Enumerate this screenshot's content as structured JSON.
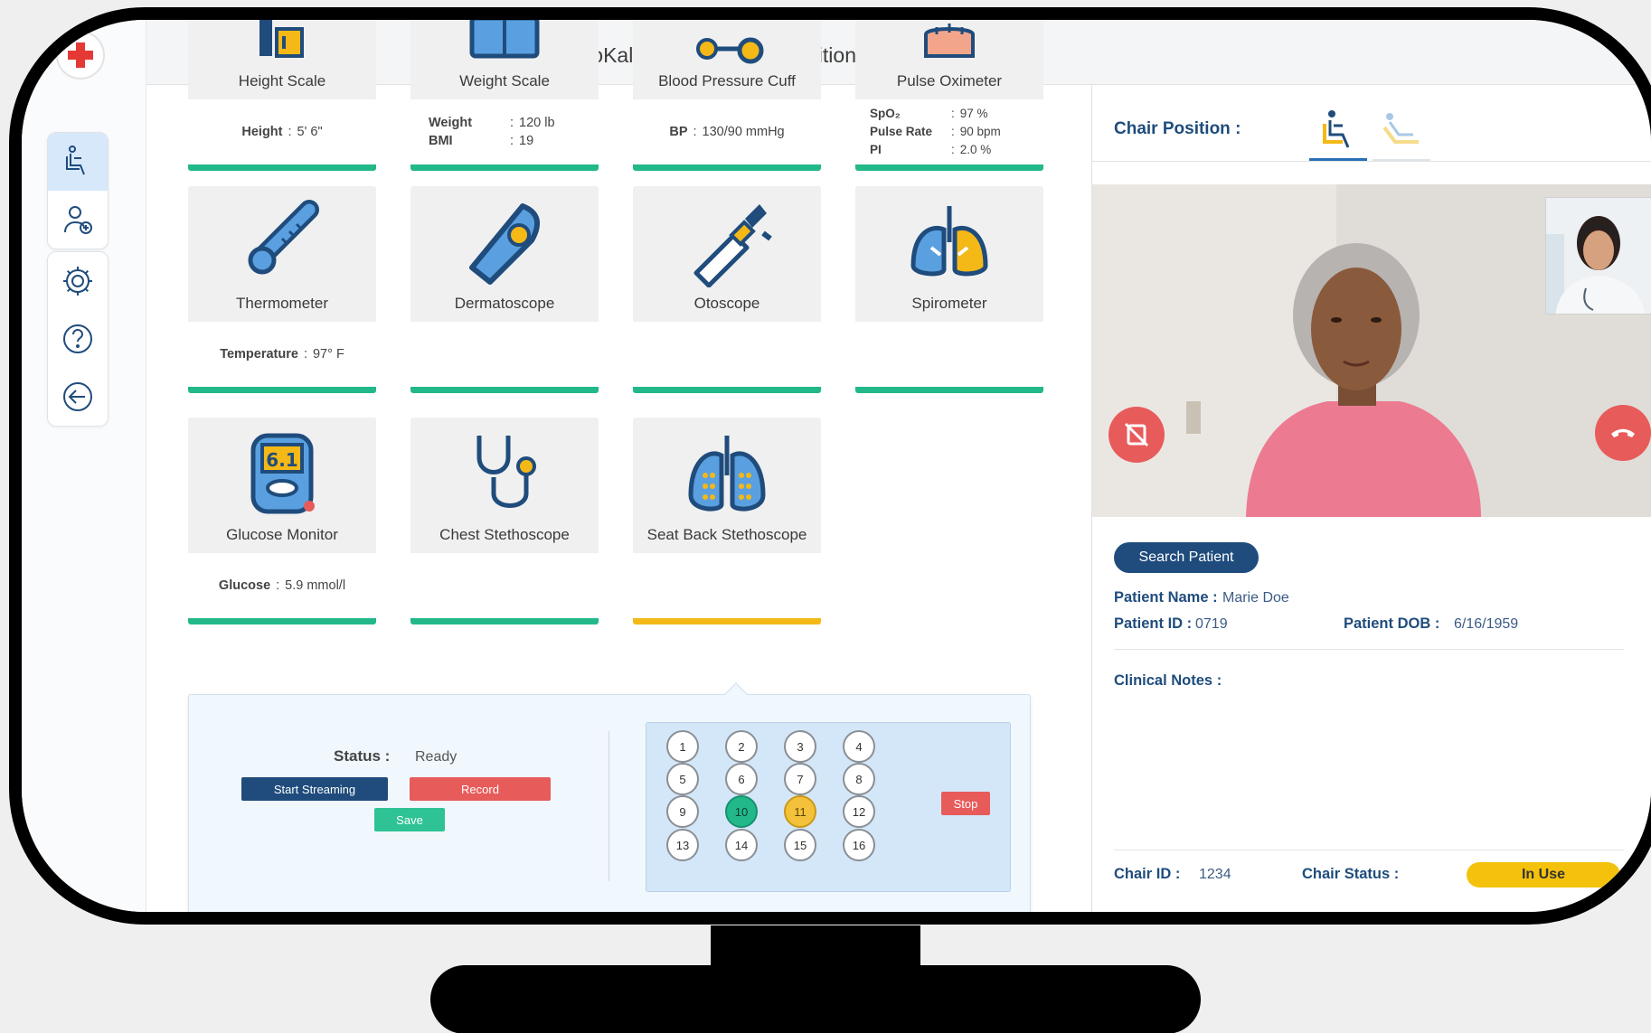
{
  "window": {
    "title": "VideoKall SMC - Nurse Practitioner Terminal"
  },
  "colors": {
    "navy": "#1f4c7c",
    "green_bar": "#22b88a",
    "yellow_bar": "#f4b817",
    "record": "#e75b5b"
  },
  "sidebar": {
    "items": [
      {
        "icon": "chair-patient-icon",
        "active": true
      },
      {
        "icon": "doctor-add-icon",
        "active": false
      },
      {
        "icon": "gear-icon",
        "active": false
      },
      {
        "icon": "help-icon",
        "active": false
      },
      {
        "icon": "logout-icon",
        "active": false
      }
    ]
  },
  "devices": [
    {
      "name": "Height Scale",
      "icon": "height-scale-icon",
      "readings": [
        {
          "label": "Height",
          "value": "5' 6\""
        }
      ]
    },
    {
      "name": "Weight Scale",
      "icon": "weight-scale-icon",
      "readings": [
        {
          "label": "Weight",
          "value": "120 lb"
        },
        {
          "label": "BMI",
          "value": "19"
        }
      ]
    },
    {
      "name": "Blood Pressure Cuff",
      "icon": "blood-pressure-cuff-icon",
      "readings": [
        {
          "label": "BP",
          "value": "130/90 mmHg"
        }
      ]
    },
    {
      "name": "Pulse Oximeter",
      "icon": "pulse-oximeter-icon",
      "readings": [
        {
          "label": "SpO₂",
          "value": "97 %"
        },
        {
          "label": "Pulse Rate",
          "value": "90 bpm"
        },
        {
          "label": "PI",
          "value": "2.0 %"
        }
      ]
    },
    {
      "name": "Thermometer",
      "icon": "thermometer-icon",
      "readings": [
        {
          "label": "Temperature",
          "value": "97° F"
        }
      ]
    },
    {
      "name": "Dermatoscope",
      "icon": "dermatoscope-icon",
      "readings": []
    },
    {
      "name": "Otoscope",
      "icon": "otoscope-icon",
      "readings": []
    },
    {
      "name": "Spirometer",
      "icon": "spirometer-icon",
      "readings": []
    },
    {
      "name": "Glucose Monitor",
      "icon": "glucose-monitor-icon",
      "readings": [
        {
          "label": "Glucose",
          "value": "5.9 mmol/l"
        }
      ]
    },
    {
      "name": "Chest Stethoscope",
      "icon": "stethoscope-icon",
      "readings": []
    },
    {
      "name": "Seat Back Stethoscope",
      "icon": "lungs-icon",
      "readings": [],
      "selected": true
    }
  ],
  "stream": {
    "status_label": "Status :",
    "status_value": "Ready",
    "start_label": "Start Streaming",
    "record_label": "Record",
    "save_label": "Save",
    "stop_label": "Stop",
    "points": [
      "1",
      "2",
      "3",
      "4",
      "5",
      "6",
      "7",
      "8",
      "9",
      "10",
      "11",
      "12",
      "13",
      "14",
      "15",
      "16"
    ],
    "active_point": "10",
    "pending_point": "11"
  },
  "right": {
    "chair_position_label": "Chair Position :",
    "search_label": "Search Patient",
    "patient_name_label": "Patient Name :",
    "patient_name": "Marie Doe",
    "patient_id_label": "Patient ID :",
    "patient_id": "0719",
    "patient_dob_label": "Patient DOB :",
    "patient_dob": "6/16/1959",
    "clinical_notes_label": "Clinical Notes :",
    "chair_id_label": "Chair ID :",
    "chair_id": "1234",
    "chair_status_label": "Chair Status :",
    "chair_status": "In Use"
  }
}
